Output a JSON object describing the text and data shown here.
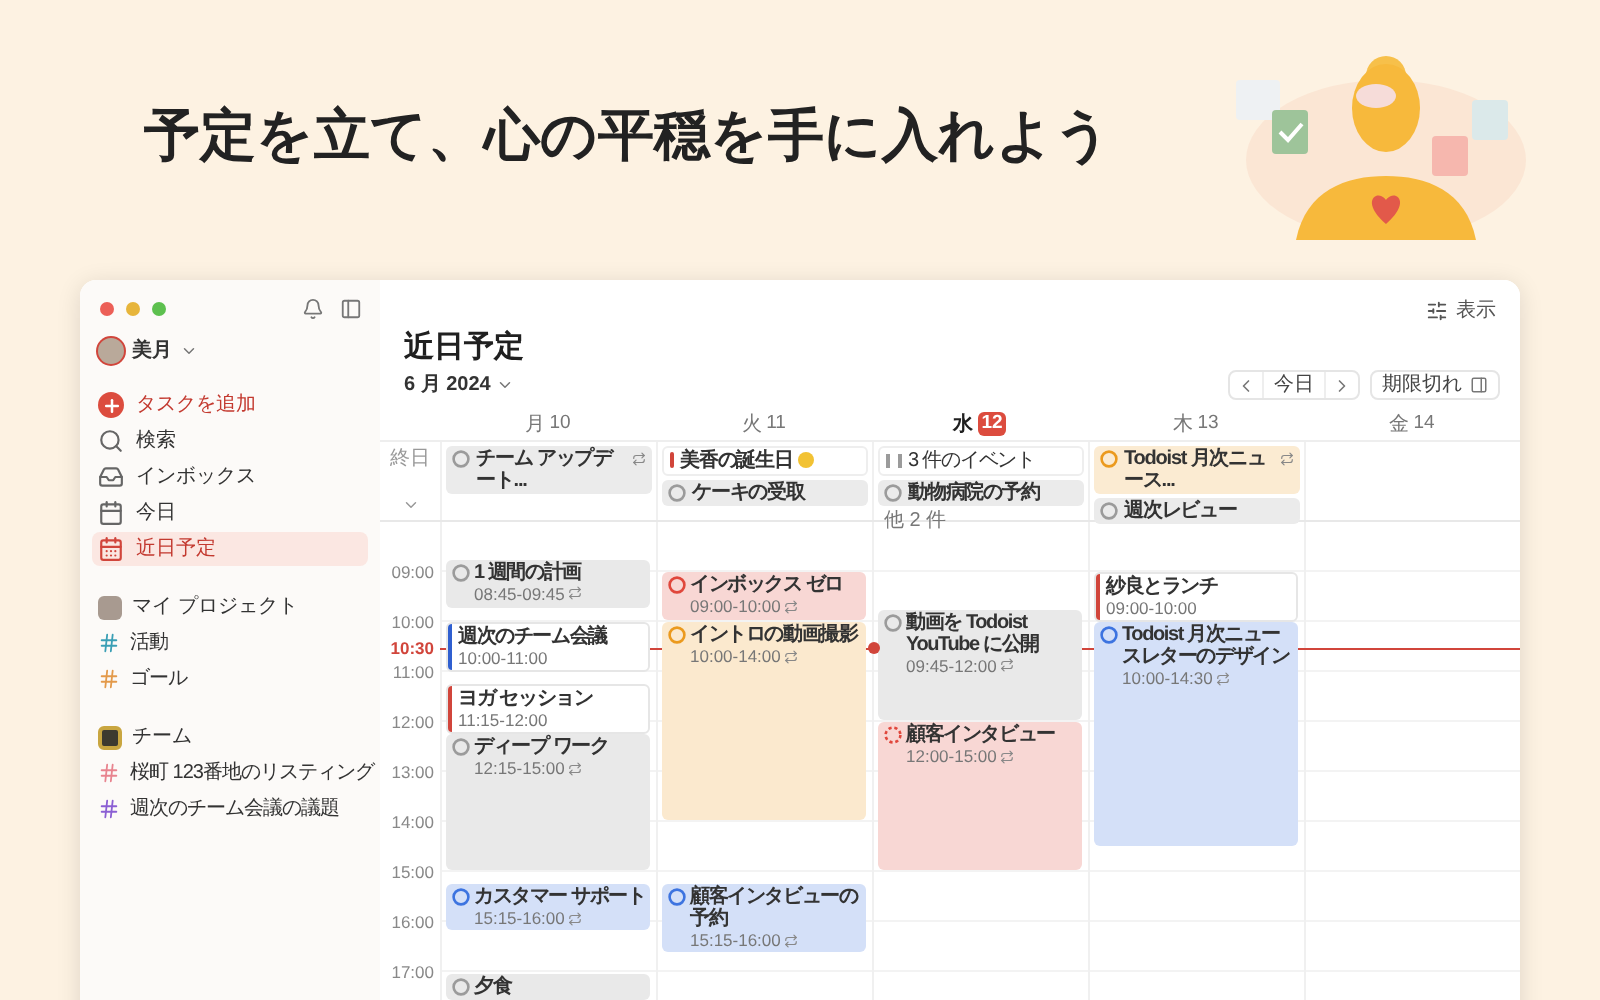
{
  "headline": "予定を立て、心の平穏を手に入れよう",
  "sidebar": {
    "user": "美月",
    "items": [
      {
        "label": "タスクを追加",
        "kind": "add",
        "selected": false
      },
      {
        "label": "検索",
        "kind": "search",
        "selected": false
      },
      {
        "label": "インボックス",
        "kind": "inbox",
        "selected": false
      },
      {
        "label": "今日",
        "kind": "today",
        "selected": false
      },
      {
        "label": "近日予定",
        "kind": "upcoming",
        "selected": true
      }
    ],
    "sections": [
      {
        "title": "マイ プロジェクト",
        "kind": "personal",
        "projects": [
          {
            "label": "活動",
            "color": "#3a9fb5"
          },
          {
            "label": "ゴール",
            "color": "#e39a4b"
          }
        ]
      },
      {
        "title": "チーム",
        "kind": "team",
        "projects": [
          {
            "label": "桜町 123番地のリスティング",
            "color": "#e8848f"
          },
          {
            "label": "週次のチーム会議の議題",
            "color": "#8b5fd3"
          }
        ]
      }
    ]
  },
  "toolbar": {
    "view_button": "表示"
  },
  "main": {
    "title": "近日予定",
    "month": "6 月 2024",
    "today_button": "今日",
    "overdue_button": "期限切れ"
  },
  "calendar": {
    "all_day_label": "終日",
    "now": "10:30",
    "time_labels": [
      "09:00",
      "10:00",
      "11:00",
      "12:00",
      "13:00",
      "14:00",
      "15:00",
      "16:00",
      "17:00"
    ],
    "days": [
      {
        "weekday": "月",
        "date": "10",
        "selected": false,
        "all_day": [
          {
            "title": "チーム アップデート...",
            "kind": "task",
            "color": "#9b9b9b",
            "recurring": true
          }
        ],
        "events": [
          {
            "title": "1 週間の計画",
            "time": "08:45-09:45",
            "kind": "task",
            "color": "#9b9b9b",
            "dashed": false,
            "recurring": true
          },
          {
            "title": "週次のチーム会議",
            "time": "10:00-11:00",
            "kind": "event",
            "color": "#2f5fd0",
            "recurring": false
          },
          {
            "title": "ヨガ セッション",
            "time": "11:15-12:00",
            "kind": "event",
            "color": "#d1453b",
            "recurring": false
          },
          {
            "title": "ディープ ワーク",
            "time": "12:15-15:00",
            "kind": "task",
            "color": "#9b9b9b",
            "dashed": false,
            "recurring": true
          },
          {
            "title": "カスタマー サポート",
            "time": "15:15-16:00",
            "kind": "task",
            "color": "#3d74e0",
            "dashed": false,
            "recurring": true
          },
          {
            "title": "夕食",
            "kind": "task",
            "color": "#9b9b9b",
            "dashed": false,
            "recurring": false
          }
        ]
      },
      {
        "weekday": "火",
        "date": "11",
        "selected": false,
        "all_day": [
          {
            "title": "美香の誕生日",
            "kind": "event",
            "color": "#d1453b",
            "recurring": false,
            "emoji": true
          },
          {
            "title": "ケーキの受取",
            "kind": "task",
            "color": "#9b9b9b",
            "recurring": false
          }
        ],
        "events": [
          {
            "title": "インボックス ゼロ",
            "time": "09:00-10:00",
            "kind": "task",
            "color": "#e0473c",
            "dashed": false,
            "recurring": true
          },
          {
            "title": "イントロの動画撮影",
            "time": "10:00-14:00",
            "kind": "task",
            "color": "#eb9a1e",
            "dashed": false,
            "recurring": true
          },
          {
            "title": "顧客インタビューの予約",
            "time": "15:15-16:00",
            "kind": "task",
            "color": "#3d74e0",
            "dashed": false,
            "recurring": true
          }
        ]
      },
      {
        "weekday": "水",
        "date": "12",
        "selected": true,
        "more": "他 2 件",
        "all_day": [
          {
            "title": "3 件のイベント",
            "kind": "group",
            "color": "#9b9b9b",
            "recurring": false
          },
          {
            "title": "動物病院の予約",
            "kind": "task",
            "color": "#9b9b9b",
            "recurring": false
          }
        ],
        "events": [
          {
            "title": "動画を Todoist YouTube に公開",
            "time": "09:45-12:00",
            "kind": "task",
            "color": "#9b9b9b",
            "dashed": false,
            "recurring": true
          },
          {
            "title": "顧客インタビュー",
            "time": "12:00-15:00",
            "kind": "task",
            "color": "#e0473c",
            "dashed": true,
            "recurring": true
          }
        ]
      },
      {
        "weekday": "木",
        "date": "13",
        "selected": false,
        "all_day": [
          {
            "title": "Todoist 月次ニュース...",
            "kind": "task",
            "color": "#eb9a1e",
            "recurring": true
          },
          {
            "title": "週次レビュー",
            "kind": "task",
            "color": "#9b9b9b",
            "recurring": false
          }
        ],
        "events": [
          {
            "title": "紗良とランチ",
            "time": "09:00-10:00",
            "kind": "event",
            "color": "#d1453b",
            "recurring": false
          },
          {
            "title": "Todoist 月次ニュースレターのデザイン",
            "time": "10:00-14:30",
            "kind": "task",
            "color": "#3d74e0",
            "dashed": false,
            "recurring": true
          }
        ]
      },
      {
        "weekday": "金",
        "date": "14",
        "selected": false
      }
    ]
  }
}
